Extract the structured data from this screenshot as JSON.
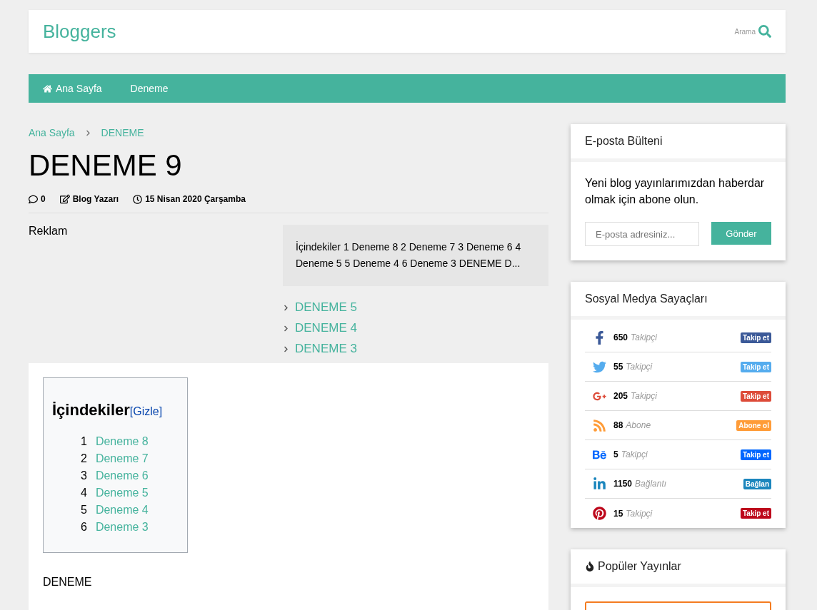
{
  "header": {
    "logo": "Bloggers",
    "search_label": "Arama"
  },
  "nav": [
    {
      "label": "Ana Sayfa",
      "kind": "home"
    },
    {
      "label": "Deneme"
    }
  ],
  "breadcrumb": [
    "Ana Sayfa",
    "DENEME"
  ],
  "post": {
    "title": "DENEME 9",
    "comments": "0",
    "author": "Blog Yazarı",
    "date": "15 Nisan 2020 Çarşamba",
    "ad_label": "Reklam",
    "summary": "İçindekiler 1 Deneme 8 2 Deneme 7 3 Deneme 6 4 Deneme 5 5 Deneme 4 6 Deneme 3 DENEME D...",
    "related": [
      "DENEME 5",
      "DENEME 4",
      "DENEME 3"
    ],
    "toc": {
      "title": "İçindekiler",
      "toggle": "[Gizle]",
      "items": [
        {
          "number": "1",
          "label": "Deneme 8"
        },
        {
          "number": "2",
          "label": "Deneme 7"
        },
        {
          "number": "3",
          "label": "Deneme 6"
        },
        {
          "number": "4",
          "label": "Deneme 5"
        },
        {
          "number": "5",
          "label": "Deneme 4"
        },
        {
          "number": "6",
          "label": "Deneme 3"
        }
      ]
    },
    "body": "DENEME"
  },
  "newsletter": {
    "title": "E-posta Bülteni",
    "text": "Yeni blog yayınlarımızdan haberdar olmak için abone olun.",
    "placeholder": "E-posta adresiniz...",
    "button": "Gönder"
  },
  "social": {
    "title": "Sosyal Medya Sayaçları",
    "items": [
      {
        "kind": "facebook",
        "count": "650",
        "unit": "Takipçi",
        "action": "Takip et",
        "color": "#3b5998"
      },
      {
        "kind": "twitter",
        "count": "55",
        "unit": "Takipçi",
        "action": "Takip et",
        "color": "#55acee"
      },
      {
        "kind": "googleplus",
        "count": "205",
        "unit": "Takipçi",
        "action": "Takip et",
        "color": "#dd4b39"
      },
      {
        "kind": "rss",
        "count": "88",
        "unit": "Abone",
        "action": "Abone ol",
        "color": "#ff9c38"
      },
      {
        "kind": "behance",
        "count": "5",
        "unit": "Takipçi",
        "action": "Takip et",
        "color": "#0067ff"
      },
      {
        "kind": "linkedin",
        "count": "1150",
        "unit": "Bağlantı",
        "action": "Bağlan",
        "color": "#1b86bd"
      },
      {
        "kind": "pinterest",
        "count": "15",
        "unit": "Takipçi",
        "action": "Takip et",
        "color": "#bd081c"
      }
    ]
  },
  "popular": {
    "title": "Popüler Yayınlar"
  }
}
